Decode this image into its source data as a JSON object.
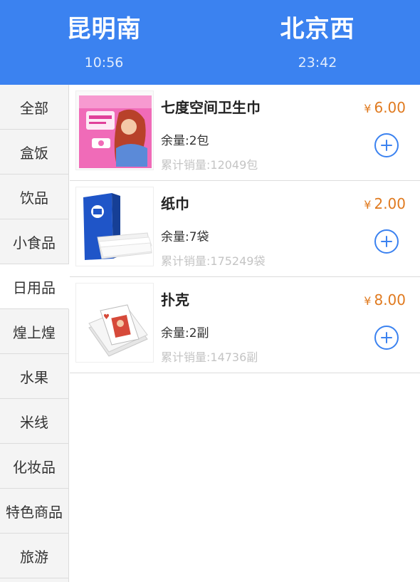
{
  "header": {
    "from": {
      "station": "昆明南",
      "time": "10:56"
    },
    "to": {
      "station": "北京西",
      "time": "23:42"
    }
  },
  "colors": {
    "primary": "#3b82f0",
    "price": "#e07a1f",
    "muted": "#c4c4c4"
  },
  "sidebar": {
    "active_index": 4,
    "items": [
      {
        "label": "全部"
      },
      {
        "label": "盒饭"
      },
      {
        "label": "饮品"
      },
      {
        "label": "小食品"
      },
      {
        "label": "日用品"
      },
      {
        "label": "煌上煌"
      },
      {
        "label": "水果"
      },
      {
        "label": "米线"
      },
      {
        "label": "化妆品"
      },
      {
        "label": "特色商品"
      },
      {
        "label": "旅游"
      }
    ]
  },
  "products": [
    {
      "name": "七度空间卫生巾",
      "currency": "¥",
      "price": "6.00",
      "stock": "余量:2包",
      "sold": "累计销量:12049包",
      "image": "sanitary-pad-package"
    },
    {
      "name": "纸巾",
      "currency": "¥",
      "price": "2.00",
      "stock": "余量:7袋",
      "sold": "累计销量:175249袋",
      "image": "tissue-box"
    },
    {
      "name": "扑克",
      "currency": "¥",
      "price": "8.00",
      "stock": "余量:2副",
      "sold": "累计销量:14736副",
      "image": "playing-cards"
    }
  ]
}
